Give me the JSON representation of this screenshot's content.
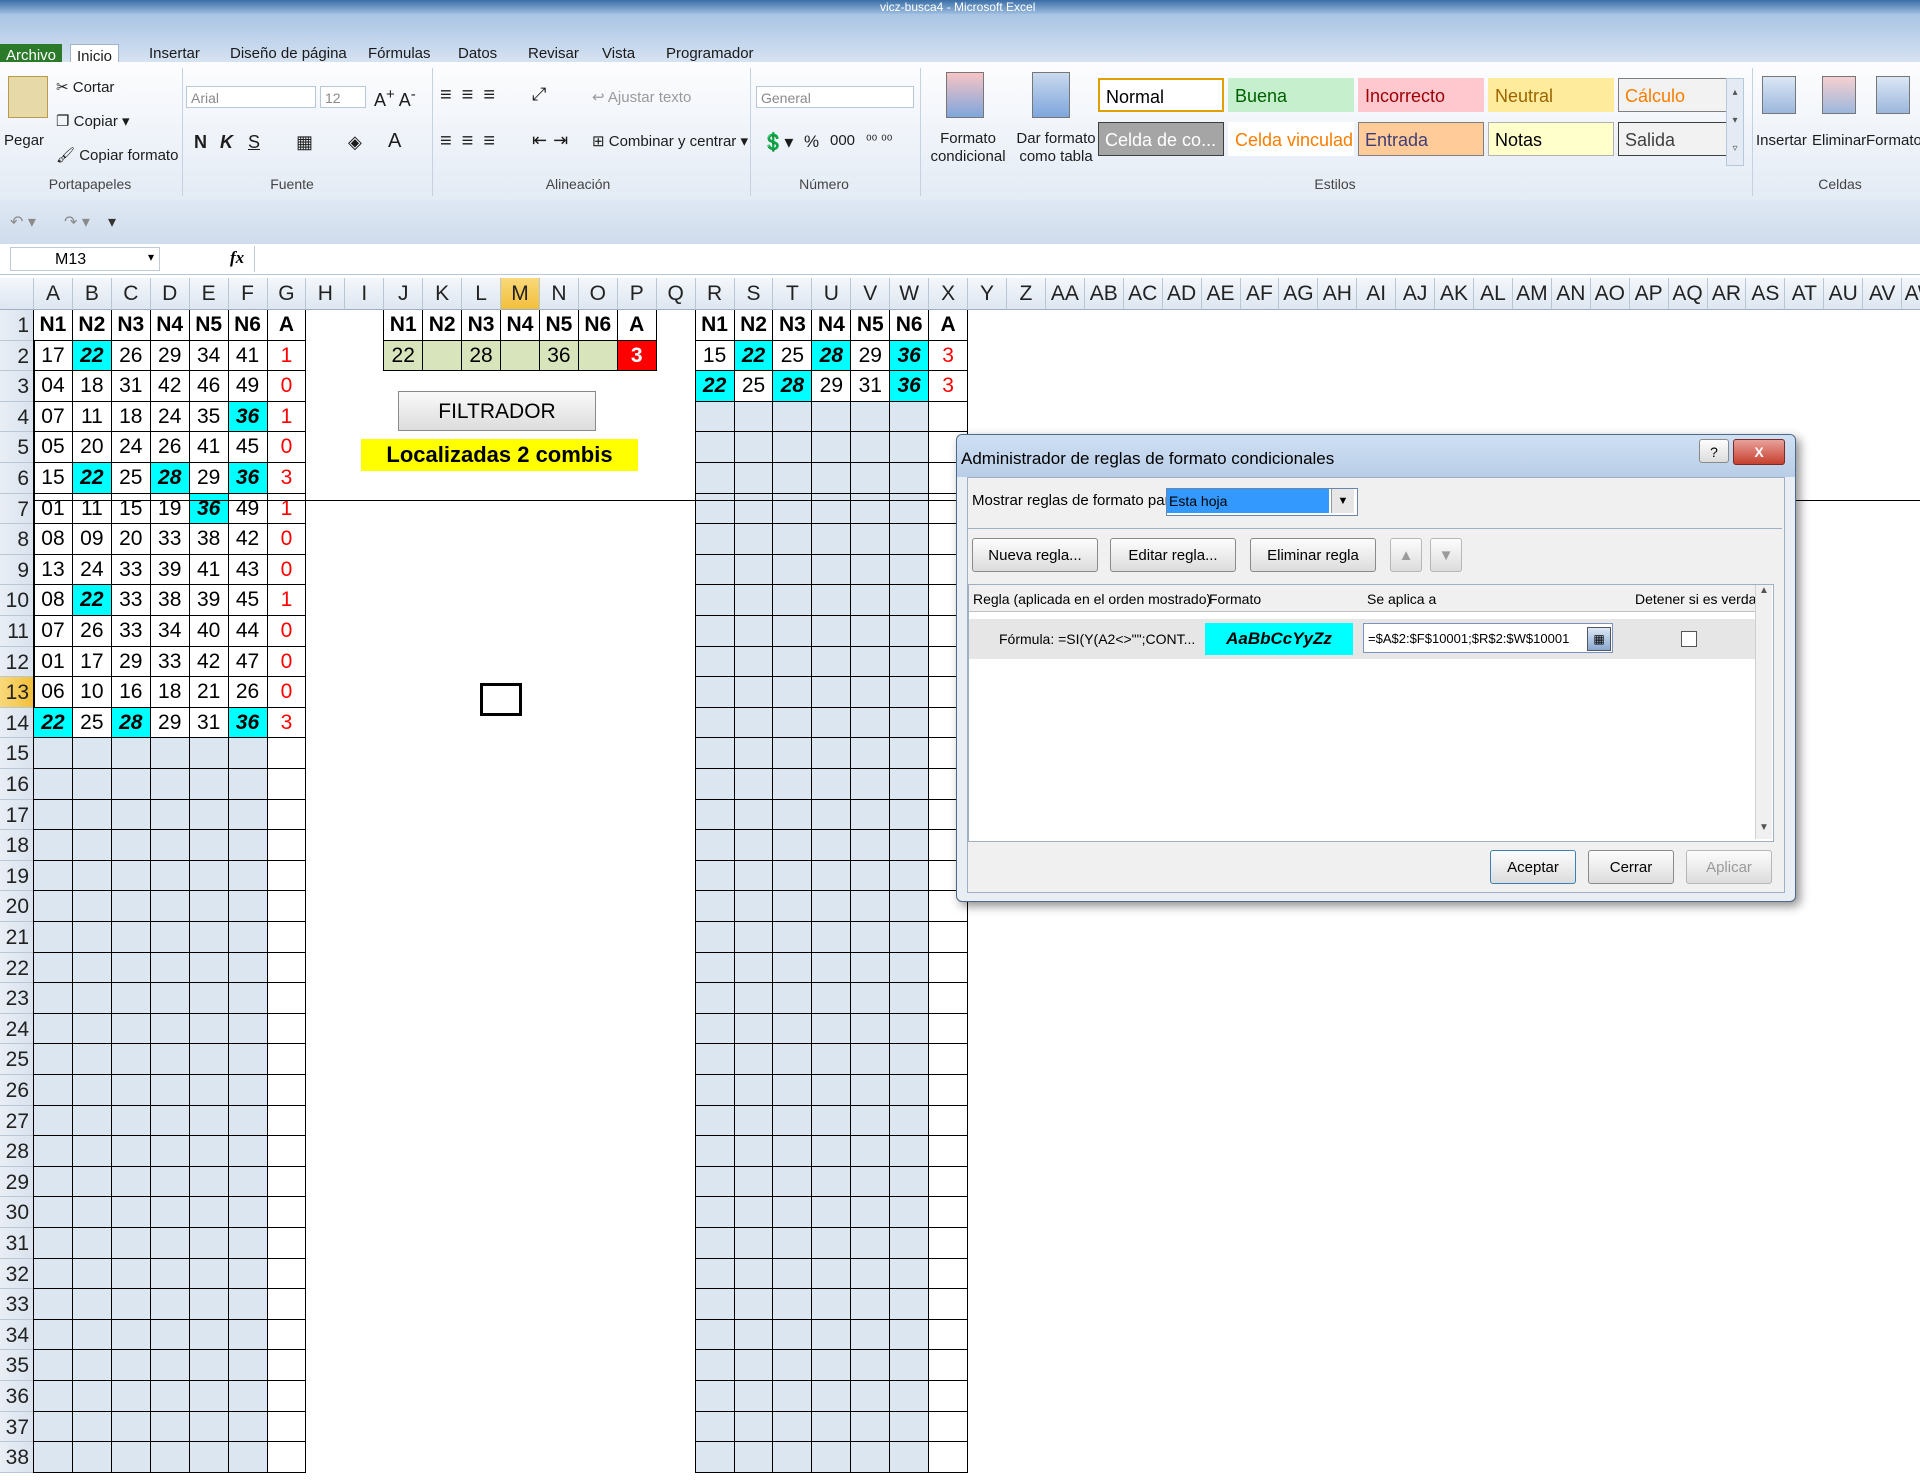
{
  "window": {
    "title": "vicz-busca4 - Microsoft Excel"
  },
  "tabs": [
    "Archivo",
    "Inicio",
    "Insertar",
    "Diseño de página",
    "Fórmulas",
    "Datos",
    "Revisar",
    "Vista",
    "Programador"
  ],
  "ribbon": {
    "clipboard": {
      "paste": "Pegar",
      "cut": "Cortar",
      "copy": "Copiar",
      "copy_format": "Copiar formato",
      "label": "Portapapeles"
    },
    "font": {
      "name": "Arial",
      "size": "12",
      "bold": "N",
      "italic": "K",
      "underline": "S",
      "label": "Fuente"
    },
    "alignment": {
      "wrap": "Ajustar texto",
      "merge": "Combinar y centrar",
      "label": "Alineación"
    },
    "number": {
      "format": "General",
      "percent": "%",
      "thousands": "000",
      "label": "Número"
    },
    "styles": {
      "cond_format": "Formato condicional",
      "table_format": "Dar formato como tabla",
      "label": "Estilos",
      "boxes": [
        {
          "text": "Normal",
          "bg": "#ffffff",
          "fg": "#000000",
          "border": "#e0a100"
        },
        {
          "text": "Buena",
          "bg": "#c6efce",
          "fg": "#006100",
          "border": "#c6efce"
        },
        {
          "text": "Incorrecto",
          "bg": "#ffc7ce",
          "fg": "#9c0006",
          "border": "#ffc7ce"
        },
        {
          "text": "Neutral",
          "bg": "#ffeb9c",
          "fg": "#9c6500",
          "border": "#ffeb9c"
        },
        {
          "text": "Cálculo",
          "bg": "#f2f2f2",
          "fg": "#fa7d00",
          "border": "#7f7f7f"
        },
        {
          "text": "Celda de co...",
          "bg": "#a5a5a5",
          "fg": "#ffffff",
          "border": "#3f3f3f"
        },
        {
          "text": "Celda vinculada",
          "bg": "#ffffff",
          "fg": "#fa7d00",
          "border": "#ffffff"
        },
        {
          "text": "Entrada",
          "bg": "#ffcc99",
          "fg": "#3f3f76",
          "border": "#7f7f7f"
        },
        {
          "text": "Notas",
          "bg": "#ffffcc",
          "fg": "#000000",
          "border": "#b2b2b2"
        },
        {
          "text": "Salida",
          "bg": "#f2f2f2",
          "fg": "#3f3f3f",
          "border": "#3f3f3f"
        }
      ]
    },
    "cells": {
      "insert": "Insertar",
      "delete": "Eliminar",
      "format": "Formato",
      "label": "Celdas"
    }
  },
  "formula_bar": {
    "name_box": "M13",
    "fx": "fx",
    "value": ""
  },
  "columns": [
    "A",
    "B",
    "C",
    "D",
    "E",
    "F",
    "G",
    "H",
    "I",
    "J",
    "K",
    "L",
    "M",
    "N",
    "O",
    "P",
    "Q",
    "R",
    "S",
    "T",
    "U",
    "V",
    "W",
    "X",
    "Y",
    "Z",
    "AA",
    "AB",
    "AC",
    "AD",
    "AE",
    "AF",
    "AG",
    "AH",
    "AI",
    "AJ",
    "AK",
    "AL",
    "AM",
    "AN",
    "AO",
    "AP",
    "AQ",
    "AR",
    "AS",
    "AT",
    "AU",
    "AV",
    "AW"
  ],
  "rows": [
    "1",
    "2",
    "3",
    "4",
    "5",
    "6",
    "7",
    "8",
    "9",
    "10",
    "11",
    "12",
    "13",
    "14",
    "15",
    "16",
    "17",
    "18",
    "19",
    "20",
    "21",
    "22",
    "23",
    "24",
    "25",
    "26",
    "27",
    "28",
    "29",
    "30",
    "31",
    "32",
    "33",
    "34",
    "35",
    "36",
    "37",
    "38"
  ],
  "selected": {
    "col": "M",
    "row": "13"
  },
  "left_table": {
    "headers": [
      "N1",
      "N2",
      "N3",
      "N4",
      "N5",
      "N6",
      "A"
    ],
    "rows": [
      [
        "17",
        "22",
        "26",
        "29",
        "34",
        "41",
        "1"
      ],
      [
        "04",
        "18",
        "31",
        "42",
        "46",
        "49",
        "0"
      ],
      [
        "07",
        "11",
        "18",
        "24",
        "35",
        "36",
        "1"
      ],
      [
        "05",
        "20",
        "24",
        "26",
        "41",
        "45",
        "0"
      ],
      [
        "15",
        "22",
        "25",
        "28",
        "29",
        "36",
        "3"
      ],
      [
        "01",
        "11",
        "15",
        "19",
        "36",
        "49",
        "1"
      ],
      [
        "08",
        "09",
        "20",
        "33",
        "38",
        "42",
        "0"
      ],
      [
        "13",
        "24",
        "33",
        "39",
        "41",
        "43",
        "0"
      ],
      [
        "08",
        "22",
        "33",
        "38",
        "39",
        "45",
        "1"
      ],
      [
        "07",
        "26",
        "33",
        "34",
        "40",
        "44",
        "0"
      ],
      [
        "01",
        "17",
        "29",
        "33",
        "42",
        "47",
        "0"
      ],
      [
        "06",
        "10",
        "16",
        "18",
        "21",
        "26",
        "0"
      ],
      [
        "22",
        "25",
        "28",
        "29",
        "31",
        "36",
        "3"
      ]
    ],
    "highlight": [
      "22",
      "28",
      "36"
    ]
  },
  "filter_table": {
    "headers": [
      "N1",
      "N2",
      "N3",
      "N4",
      "N5",
      "N6",
      "A"
    ],
    "values": [
      "22",
      "",
      "28",
      "",
      "36",
      "",
      "3"
    ],
    "button": "FILTRADOR",
    "status": "Localizadas 2 combis"
  },
  "right_table": {
    "headers": [
      "N1",
      "N2",
      "N3",
      "N4",
      "N5",
      "N6",
      "A"
    ],
    "rows": [
      [
        "15",
        "22",
        "25",
        "28",
        "29",
        "36",
        "3"
      ],
      [
        "22",
        "25",
        "28",
        "29",
        "31",
        "36",
        "3"
      ]
    ]
  },
  "dialog": {
    "title": "Administrador de reglas de formato condicionales",
    "show_label": "Mostrar reglas de formato para:",
    "show_value": "Esta hoja",
    "new_rule": "Nueva regla...",
    "edit_rule": "Editar regla...",
    "delete_rule": "Eliminar regla",
    "col_rule": "Regla (aplicada en el orden mostrado)",
    "col_format": "Formato",
    "col_applies": "Se aplica a",
    "col_stop": "Detener si es verdad",
    "rule_text": "Fórmula: =SI(Y(A2<>\"\";CONT...",
    "format_preview": "AaBbCcYyZz",
    "applies_to": "=$A$2:$F$10001;$R$2:$W$10001",
    "ok": "Aceptar",
    "close": "Cerrar",
    "apply": "Aplicar",
    "help": "?",
    "x": "X"
  }
}
